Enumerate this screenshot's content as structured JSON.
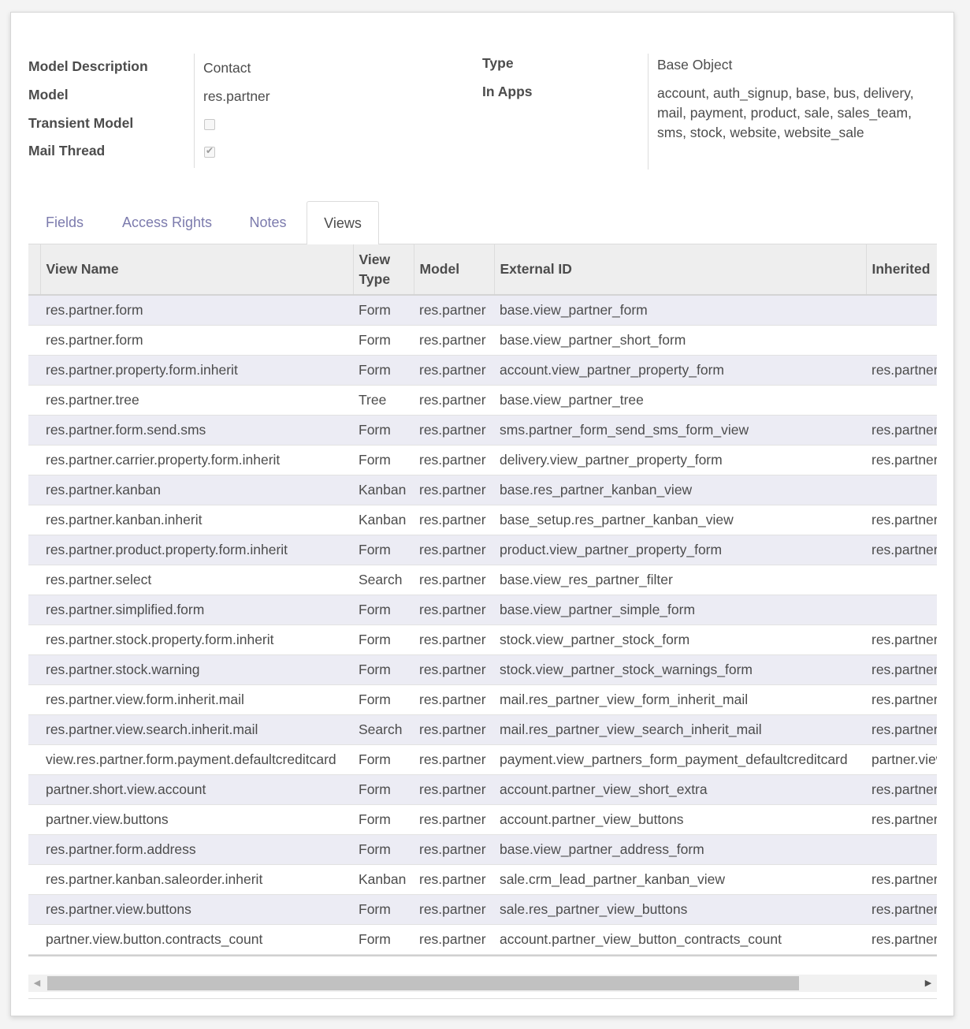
{
  "model_info": {
    "description_label": "Model Description",
    "description_value": "Contact",
    "model_label": "Model",
    "model_value": "res.partner",
    "transient_label": "Transient Model",
    "transient_checked": false,
    "mail_thread_label": "Mail Thread",
    "mail_thread_checked": true,
    "type_label": "Type",
    "type_value": "Base Object",
    "in_apps_label": "In Apps",
    "in_apps_value": "account, auth_signup, base, bus, delivery, mail, payment, product, sale, sales_team, sms, stock, website, website_sale"
  },
  "tabs": [
    {
      "label": "Fields",
      "active": false
    },
    {
      "label": "Access Rights",
      "active": false
    },
    {
      "label": "Notes",
      "active": false
    },
    {
      "label": "Views",
      "active": true
    }
  ],
  "views_table": {
    "columns": [
      "View Name",
      "View Type",
      "Model",
      "External ID",
      "Inherited"
    ],
    "rows": [
      [
        "res.partner.form",
        "Form",
        "res.partner",
        "base.view_partner_form",
        ""
      ],
      [
        "res.partner.form",
        "Form",
        "res.partner",
        "base.view_partner_short_form",
        ""
      ],
      [
        "res.partner.property.form.inherit",
        "Form",
        "res.partner",
        "account.view_partner_property_form",
        "res.partner"
      ],
      [
        "res.partner.tree",
        "Tree",
        "res.partner",
        "base.view_partner_tree",
        ""
      ],
      [
        "res.partner.form.send.sms",
        "Form",
        "res.partner",
        "sms.partner_form_send_sms_form_view",
        "res.partner"
      ],
      [
        "res.partner.carrier.property.form.inherit",
        "Form",
        "res.partner",
        "delivery.view_partner_property_form",
        "res.partner"
      ],
      [
        "res.partner.kanban",
        "Kanban",
        "res.partner",
        "base.res_partner_kanban_view",
        ""
      ],
      [
        "res.partner.kanban.inherit",
        "Kanban",
        "res.partner",
        "base_setup.res_partner_kanban_view",
        "res.partner"
      ],
      [
        "res.partner.product.property.form.inherit",
        "Form",
        "res.partner",
        "product.view_partner_property_form",
        "res.partner"
      ],
      [
        "res.partner.select",
        "Search",
        "res.partner",
        "base.view_res_partner_filter",
        ""
      ],
      [
        "res.partner.simplified.form",
        "Form",
        "res.partner",
        "base.view_partner_simple_form",
        ""
      ],
      [
        "res.partner.stock.property.form.inherit",
        "Form",
        "res.partner",
        "stock.view_partner_stock_form",
        "res.partner"
      ],
      [
        "res.partner.stock.warning",
        "Form",
        "res.partner",
        "stock.view_partner_stock_warnings_form",
        "res.partner"
      ],
      [
        "res.partner.view.form.inherit.mail",
        "Form",
        "res.partner",
        "mail.res_partner_view_form_inherit_mail",
        "res.partner"
      ],
      [
        "res.partner.view.search.inherit.mail",
        "Search",
        "res.partner",
        "mail.res_partner_view_search_inherit_mail",
        "res.partner"
      ],
      [
        "view.res.partner.form.payment.defaultcreditcard",
        "Form",
        "res.partner",
        "payment.view_partners_form_payment_defaultcreditcard",
        "partner.view"
      ],
      [
        "partner.short.view.account",
        "Form",
        "res.partner",
        "account.partner_view_short_extra",
        "res.partner"
      ],
      [
        "partner.view.buttons",
        "Form",
        "res.partner",
        "account.partner_view_buttons",
        "res.partner"
      ],
      [
        "res.partner.form.address",
        "Form",
        "res.partner",
        "base.view_partner_address_form",
        ""
      ],
      [
        "res.partner.kanban.saleorder.inherit",
        "Kanban",
        "res.partner",
        "sale.crm_lead_partner_kanban_view",
        "res.partner"
      ],
      [
        "res.partner.view.buttons",
        "Form",
        "res.partner",
        "sale.res_partner_view_buttons",
        "res.partner"
      ],
      [
        "partner.view.button.contracts_count",
        "Form",
        "res.partner",
        "account.partner_view_button_contracts_count",
        "res.partner"
      ]
    ]
  },
  "scrollbar": {
    "left_arrow": "◀",
    "right_arrow": "▶"
  }
}
